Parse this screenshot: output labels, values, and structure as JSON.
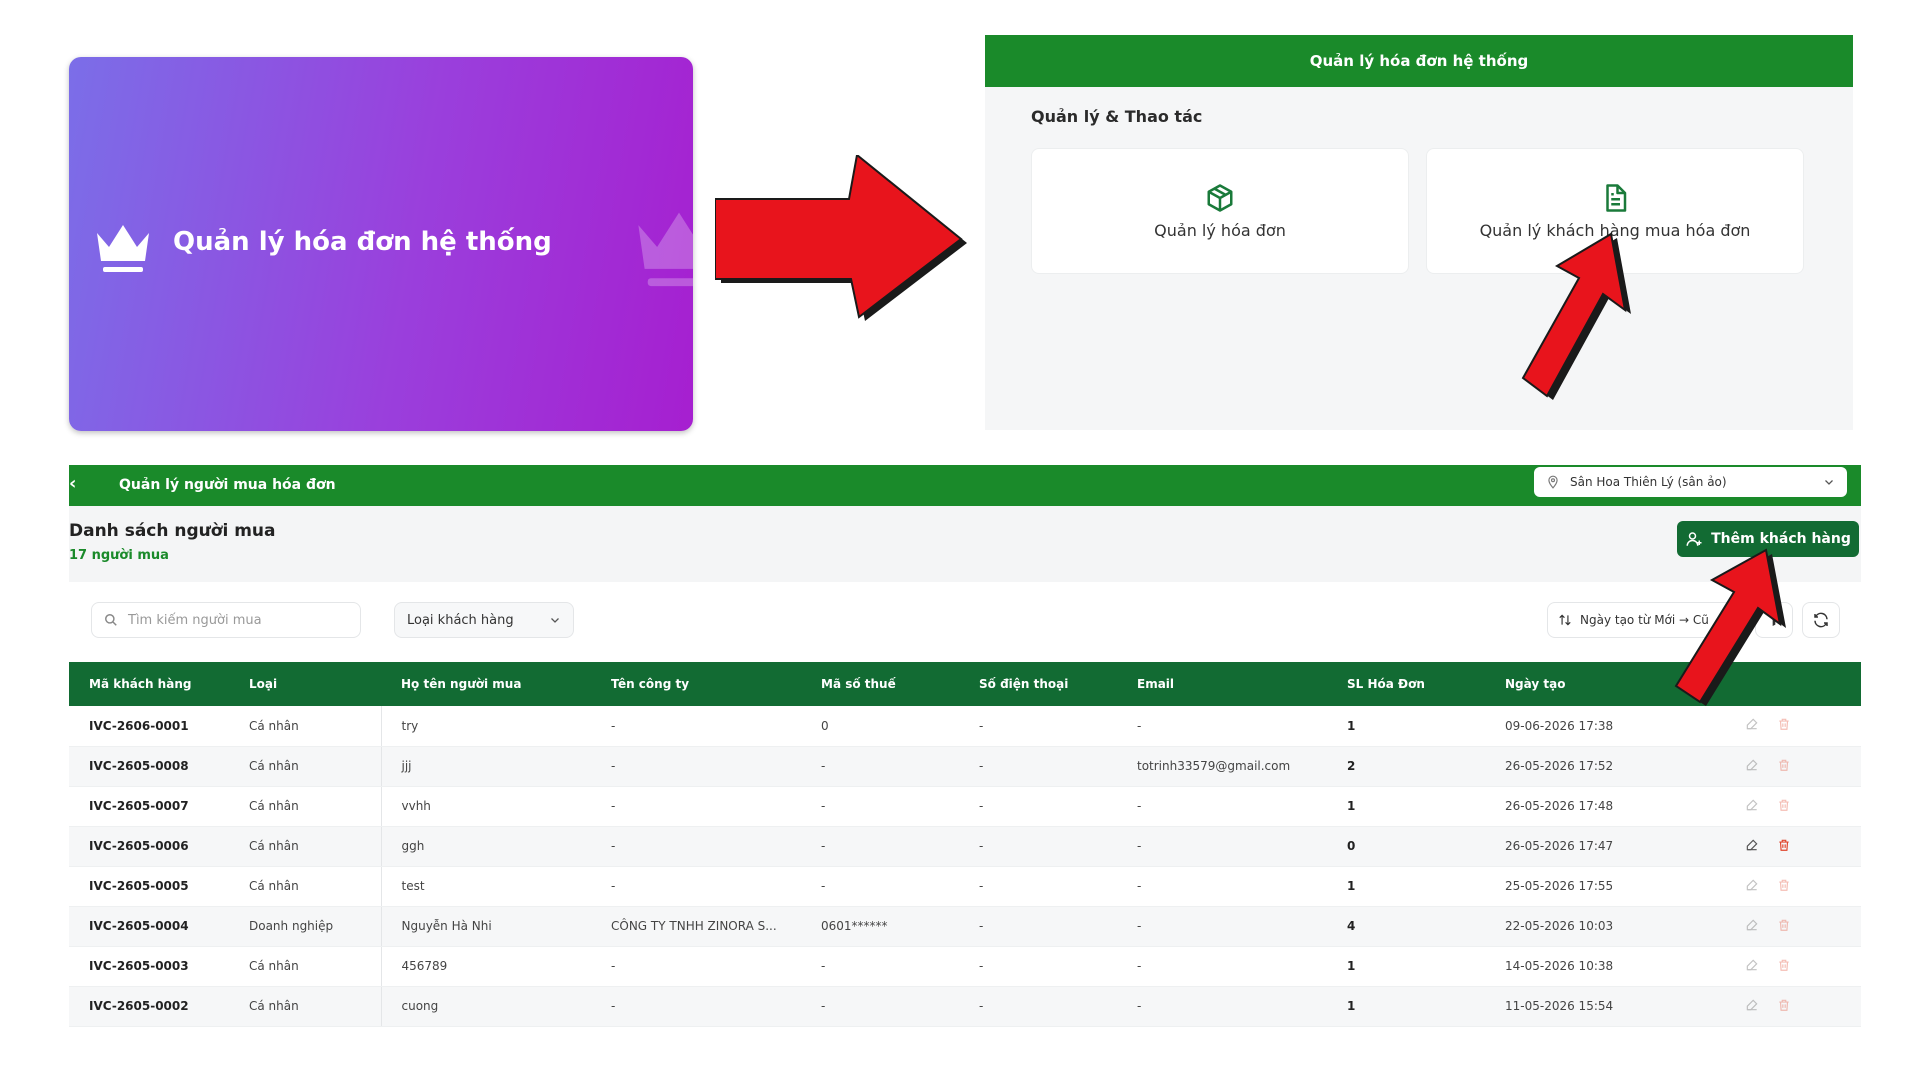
{
  "promo": {
    "title": "Quản lý hóa đơn hệ thống"
  },
  "menu": {
    "header": "Quản lý hóa đơn hệ thống",
    "section": "Quản lý & Thao tác",
    "tiles": [
      {
        "label": "Quản lý hóa đơn",
        "icon": "package-icon"
      },
      {
        "label": "Quản lý khách hàng mua hóa đơn",
        "icon": "document-icon"
      }
    ]
  },
  "app": {
    "title": "Quản lý người mua hóa đơn",
    "store": "Sân Hoa Thiên Lý (sân ảo)",
    "page_title": "Danh sách người mua",
    "count": "17 người mua",
    "add_button": "Thêm khách hàng",
    "search_placeholder": "Tìm kiếm người mua",
    "type_filter": "Loại khách hàng",
    "sort": "Ngày tạo từ Mới → Cũ"
  },
  "table": {
    "columns": [
      "Mã khách hàng",
      "Loại",
      "Họ tên người mua",
      "Tên công ty",
      "Mã số thuế",
      "Số điện thoại",
      "Email",
      "SL Hóa Đơn",
      "Ngày tạo"
    ],
    "rows": [
      [
        "IVC-2606-0001",
        "Cá nhân",
        "try",
        "-",
        "0",
        "-",
        "-",
        "1",
        "09-06-2026 17:38"
      ],
      [
        "IVC-2605-0008",
        "Cá nhân",
        "jjj",
        "-",
        "-",
        "-",
        "totrinh33579@gmail.com",
        "2",
        "26-05-2026 17:52"
      ],
      [
        "IVC-2605-0007",
        "Cá nhân",
        "vvhh",
        "-",
        "-",
        "-",
        "-",
        "1",
        "26-05-2026 17:48"
      ],
      [
        "IVC-2605-0006",
        "Cá nhân",
        "ggh",
        "-",
        "-",
        "-",
        "-",
        "0",
        "26-05-2026 17:47"
      ],
      [
        "IVC-2605-0005",
        "Cá nhân",
        "test",
        "-",
        "-",
        "-",
        "-",
        "1",
        "25-05-2026 17:55"
      ],
      [
        "IVC-2605-0004",
        "Doanh nghiệp",
        "Nguyễn Hà Nhi",
        "CÔNG TY TNHH ZINORA S...",
        "0601******",
        "-",
        "-",
        "4",
        "22-05-2026 10:03"
      ],
      [
        "IVC-2605-0003",
        "Cá nhân",
        "456789",
        "-",
        "-",
        "-",
        "-",
        "1",
        "14-05-2026 10:38"
      ],
      [
        "IVC-2605-0002",
        "Cá nhân",
        "cuong",
        "-",
        "-",
        "-",
        "-",
        "1",
        "11-05-2026 15:54"
      ]
    ]
  },
  "colors": {
    "primary_green": "#1a8a2a",
    "dark_green": "#126b33",
    "arrow_red": "#e8141c",
    "delete_red": "#e0442b"
  }
}
